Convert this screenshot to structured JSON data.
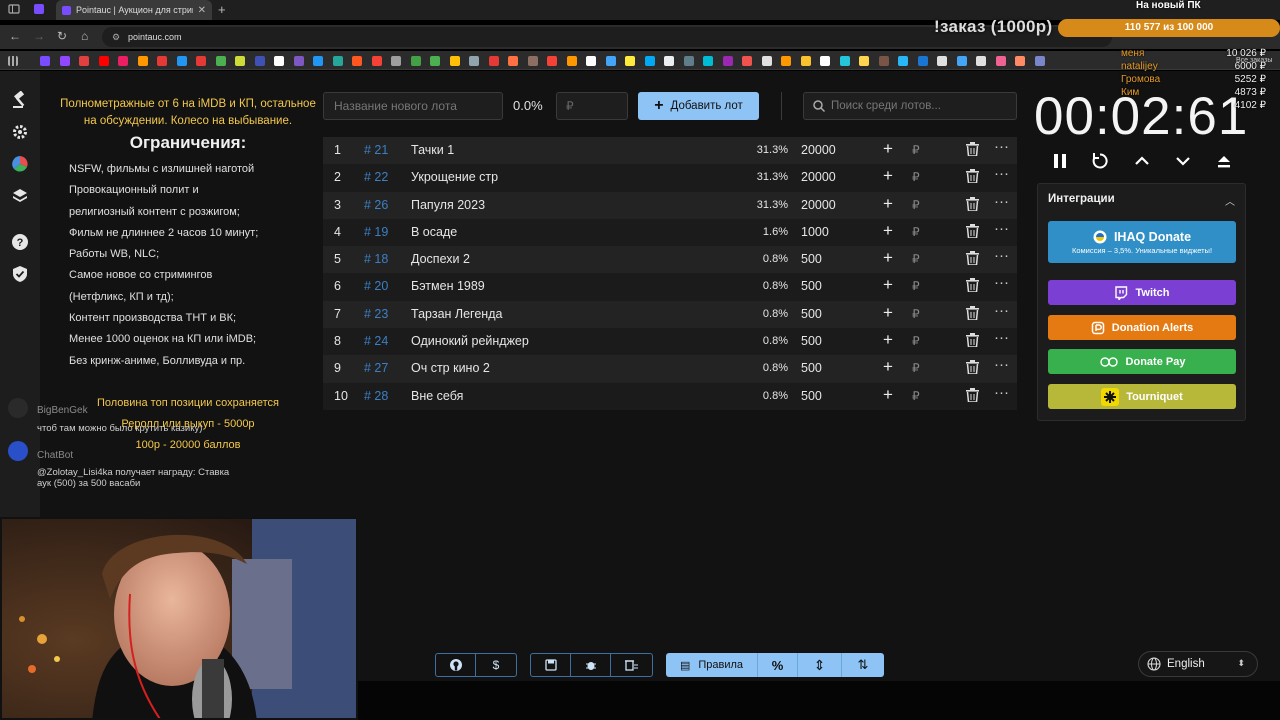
{
  "browser": {
    "tab_title": "Pointauc | Аукцион для стрима",
    "url": "pointauc.com"
  },
  "overlay": {
    "order_text": "!заказ (1000р)",
    "goal_title": "На новый ПК",
    "goal_progress": "110 577  из 100 000",
    "goal_progress_fraction": 1.0,
    "all_orders": "Все заказы",
    "donors": [
      {
        "name": "меня",
        "amount": "10 026 ₽"
      },
      {
        "name": "natalijey",
        "amount": "6000 ₽"
      },
      {
        "name": "Громова",
        "amount": "5252 ₽"
      },
      {
        "name": "Ким",
        "amount": "4873 ₽"
      },
      {
        "name": "",
        "amount": "4102 ₽"
      }
    ],
    "accent": "#d68a1a"
  },
  "rules": {
    "intro": "Полнометражные от 6 на iMDB и КП, остальное на обсуждении. Колесо на выбывание.",
    "heading": "Ограничения:",
    "lines": [
      "NSFW, фильмы с излишней наготой",
      "Провокационный полит и",
      "религиозный контент с розжигом;",
      "Фильм не длиннее 2 часов 10 минут;",
      "Работы WB, NLC;",
      "Самое новое со стримингов",
      "(Нетфликс, КП и тд);",
      "Контент производства ТНТ и ВК;",
      "Менее 1000 оценок на КП или iMDB;",
      "Без кринж-аниме, Болливуда и пр."
    ],
    "footer1": "Половина топ позиции сохраняется",
    "footer2": "Реролл или выкуп - 5000р",
    "footer3": "100р - 20000 баллов"
  },
  "controls": {
    "new_lot_placeholder": "Название нового лота",
    "percent": "0.0%",
    "currency_placeholder": "₽",
    "add_label": "Добавить лот",
    "search_placeholder": "Поиск среди лотов..."
  },
  "lots": [
    {
      "num": "1",
      "id": "# 21",
      "name": "Тачки 1",
      "pct": "31.3%",
      "amount": "20000"
    },
    {
      "num": "2",
      "id": "# 22",
      "name": "Укрощение стр",
      "pct": "31.3%",
      "amount": "20000"
    },
    {
      "num": "3",
      "id": "# 26",
      "name": "Папуля 2023",
      "pct": "31.3%",
      "amount": "20000"
    },
    {
      "num": "4",
      "id": "# 19",
      "name": "В осаде",
      "pct": "1.6%",
      "amount": "1000"
    },
    {
      "num": "5",
      "id": "# 18",
      "name": "Доспехи 2",
      "pct": "0.8%",
      "amount": "500"
    },
    {
      "num": "6",
      "id": "# 20",
      "name": "Бэтмен 1989",
      "pct": "0.8%",
      "amount": "500"
    },
    {
      "num": "7",
      "id": "# 23",
      "name": "Тарзан Легенда",
      "pct": "0.8%",
      "amount": "500"
    },
    {
      "num": "8",
      "id": "# 24",
      "name": "Одинокий рейнджер",
      "pct": "0.8%",
      "amount": "500"
    },
    {
      "num": "9",
      "id": "# 27",
      "name": "Оч стр кино 2",
      "pct": "0.8%",
      "amount": "500"
    },
    {
      "num": "10",
      "id": "# 28",
      "name": "Вне себя",
      "pct": "0.8%",
      "amount": "500"
    }
  ],
  "lot_row": {
    "plus": "+",
    "currency": "₽",
    "more": "···"
  },
  "timer": {
    "value": "00:02:61"
  },
  "integrations": {
    "title": "Интеграции",
    "donate": {
      "label": "IHAQ Donate",
      "sub": "Комиссия – 3,5%. Уникальные виджеты!",
      "color": "#2f8fc6"
    },
    "twitch": {
      "label": "Twitch",
      "color": "#7c3fd4"
    },
    "donation_alerts": {
      "label": "Donation Alerts",
      "color": "#e57a12"
    },
    "donate_pay": {
      "label": "Donate Pay",
      "color": "#38b04e"
    },
    "tourniquet": {
      "label": "Tourniquet",
      "color": "#b7b83a"
    }
  },
  "chat": [
    {
      "name": "BigBenGek",
      "message": "чтоб там можно было крутить казику)"
    },
    {
      "name": "ChatBot",
      "message": "@Zolotay_Lisi4ka получает награду: Ставка аук (500) за 500 васаби"
    }
  ],
  "bottom": {
    "rules_label": "Правила",
    "percent_icon": "%",
    "language": "English"
  }
}
